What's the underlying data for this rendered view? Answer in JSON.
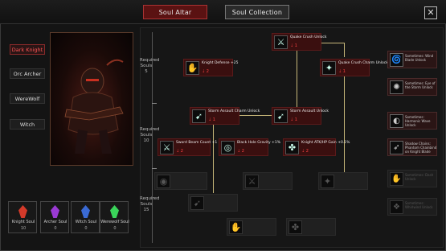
{
  "tabs": {
    "altar": "Soul Altar",
    "collection": "Soul Collection"
  },
  "close_label": "✕",
  "classes": [
    {
      "label": "Dark Knight",
      "active": true
    },
    {
      "label": "Orc Archer",
      "active": false
    },
    {
      "label": "WereWolf",
      "active": false
    },
    {
      "label": "Witch",
      "active": false
    }
  ],
  "souls": [
    {
      "name": "Knight Soul",
      "count": "10",
      "color": "#d43a2a"
    },
    {
      "name": "Archer Soul",
      "count": "0",
      "color": "#9a3ad4"
    },
    {
      "name": "Witch Soul",
      "count": "0",
      "color": "#3a6ad4"
    },
    {
      "name": "Werewolf Soul",
      "count": "0",
      "color": "#3ad45a"
    }
  ],
  "tiers": [
    {
      "line1": "Required",
      "line2": "Souls",
      "line3": "5"
    },
    {
      "line1": "Required",
      "line2": "Souls",
      "line3": "10"
    },
    {
      "line1": "Required",
      "line2": "Souls",
      "line3": "15"
    }
  ],
  "nodes": {
    "quake_unlock": {
      "title": "Quake Crush Unlock",
      "cost": "1"
    },
    "knight_defense": {
      "title": "Knight Defense +25",
      "cost": "2"
    },
    "quake_charge": {
      "title": "Quake Crush Charm Unlock",
      "cost": "1"
    },
    "storm_charge": {
      "title": "Storm Assault Charm Unlock",
      "cost": "1"
    },
    "storm_unlock": {
      "title": "Storm Assault Unlock",
      "cost": "1"
    },
    "sword_beam": {
      "title": "Sword Beam Count +1",
      "cost": "2"
    },
    "black_hole": {
      "title": "Black Hole Gravity +1%",
      "cost": "2"
    },
    "knight_atk": {
      "title": "Knight ATK/HP Gain +0.1%",
      "cost": "2"
    }
  },
  "side_nodes": [
    {
      "title": "Sometimes: Wind Blade Unlock",
      "icon": "🌀"
    },
    {
      "title": "Sometimes: Eye of the Storm Unlock",
      "icon": "✺"
    },
    {
      "title": "Sometimes: Harmonic Wave Unlock",
      "icon": "◐"
    },
    {
      "title": "Shadow Chains: Phantom Chainbind on Knight Blade",
      "icon": "➶"
    },
    {
      "title": "Sometimes: Dash Unlock",
      "icon": "✋"
    },
    {
      "title": "Sometimes: Whirlwind Unlock",
      "icon": "❖"
    }
  ]
}
